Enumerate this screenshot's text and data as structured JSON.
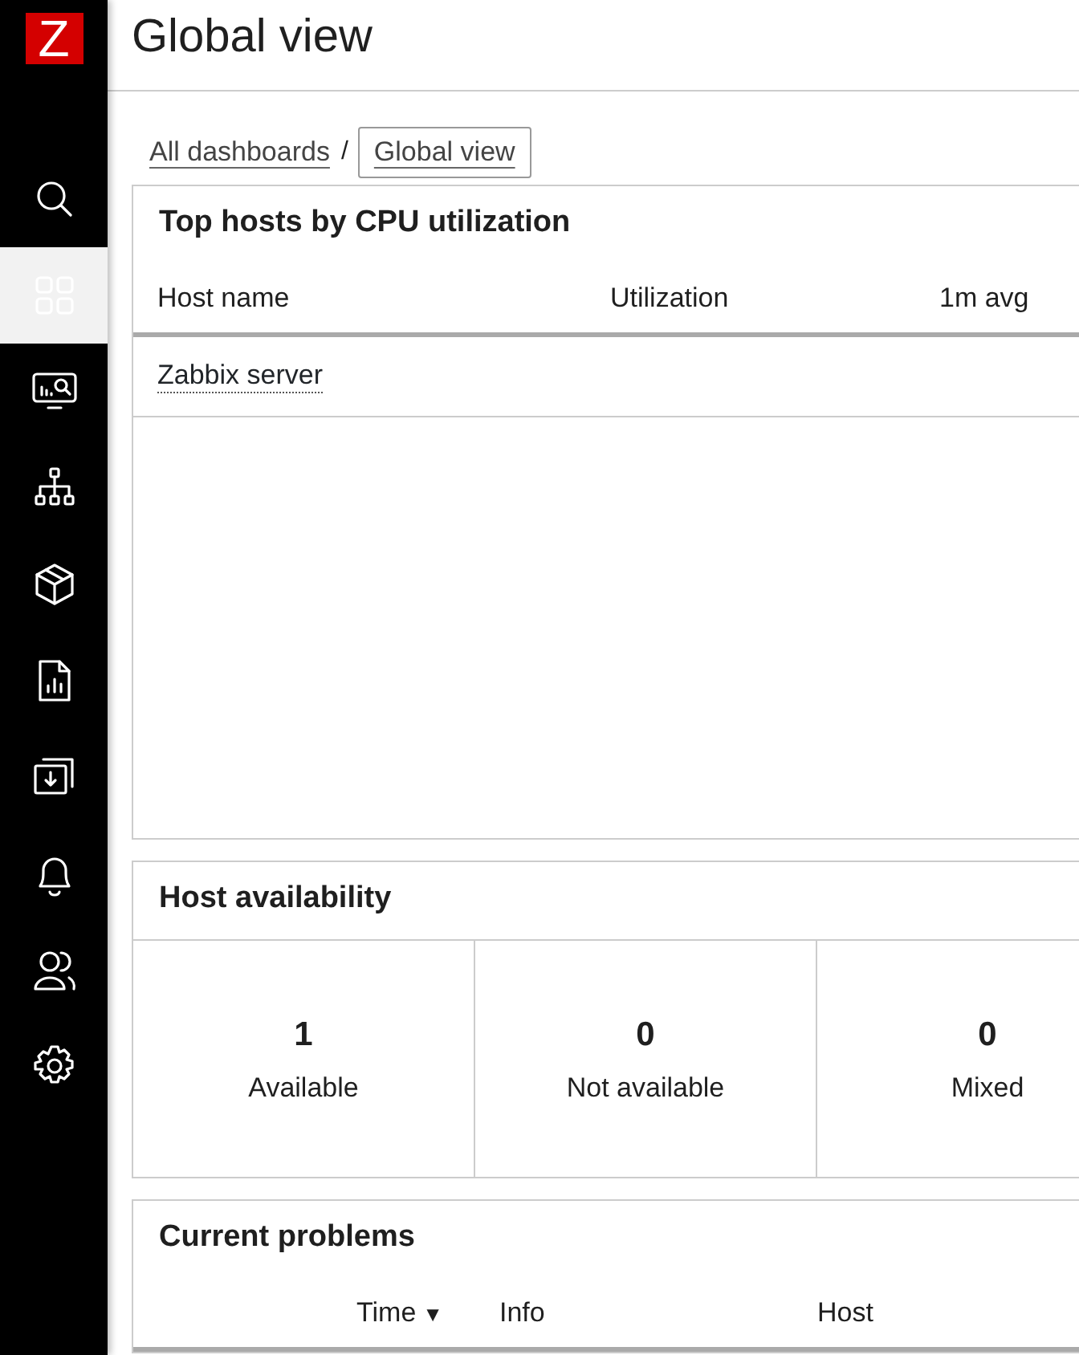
{
  "sidebar": {
    "logo": "Z",
    "items": [
      {
        "kind": "search",
        "selected": false
      },
      {
        "kind": "dashboard",
        "selected": true
      },
      {
        "kind": "monitoring",
        "selected": false
      },
      {
        "kind": "hierarchy",
        "selected": false
      },
      {
        "kind": "inventory",
        "selected": false
      },
      {
        "kind": "reports",
        "selected": false
      },
      {
        "kind": "import",
        "selected": false
      },
      {
        "kind": "alerts",
        "selected": false
      },
      {
        "kind": "users",
        "selected": false
      },
      {
        "kind": "settings",
        "selected": false
      }
    ]
  },
  "page_title": "Global view",
  "breadcrumb": [
    {
      "label": "All dashboards",
      "selected": false
    },
    {
      "label": "Global view",
      "selected": true
    }
  ],
  "breadcrumb_separator": "/",
  "top_hosts": {
    "title": "Top hosts by CPU utilization",
    "columns": [
      "Host name",
      "Utilization",
      "1m avg"
    ],
    "rows": [
      {
        "host": "Zabbix server"
      }
    ]
  },
  "host_availability": {
    "title": "Host availability",
    "cells": [
      {
        "count": "1",
        "label": "Available"
      },
      {
        "count": "0",
        "label": "Not available"
      },
      {
        "count": "0",
        "label": "Mixed"
      }
    ]
  },
  "current_problems": {
    "title": "Current problems",
    "columns": [
      {
        "label": "Time",
        "sort": "▼"
      },
      {
        "label": "Info"
      },
      {
        "label": "Host"
      }
    ]
  }
}
